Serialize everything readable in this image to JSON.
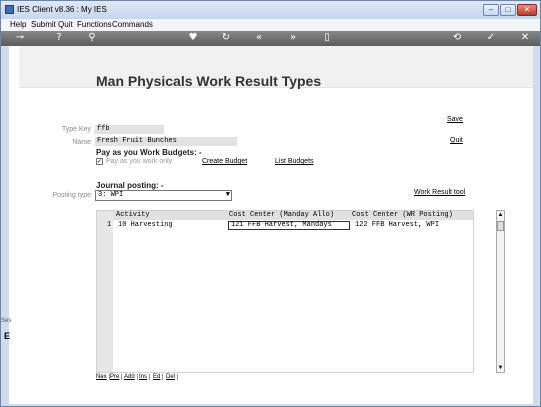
{
  "window": {
    "title": "IES Client v8.36 : My IES"
  },
  "menu": [
    "Help",
    "Submit",
    "Quit",
    "Functions",
    "Commands"
  ],
  "toolbar": {
    "icons": [
      "key-icon",
      "help-icon",
      "search-icon",
      "heart-icon",
      "refresh-icon",
      "rewind-icon",
      "fast-forward-icon",
      "bookmark-icon",
      "back-icon",
      "check-icon",
      "close-icon"
    ]
  },
  "page": {
    "title": "Man Physicals Work Result Types",
    "save_label": "Save",
    "quit_label": "Quit",
    "type_key_label": "Type Key",
    "type_key_value": "ffb",
    "name_label": "Name",
    "name_value": "Fresh Fruit Bunches",
    "pay_heading": "Pay as you Work Budgets: -",
    "pay_checkbox_label": "Pay as you work only",
    "create_budget_label": "Create Budget",
    "list_budgets_label": "List Budgets",
    "journal_heading": "Journal posting: -",
    "posting_type_label": "Posting type",
    "posting_type_value": "3: WPI",
    "work_result_tool_label": "Work Result tool"
  },
  "grid": {
    "headers": [
      "Activity",
      "Cost Center (Manday Allo)",
      "Cost Center (WR Posting)"
    ],
    "rows": [
      {
        "num": "1",
        "activity": "10 Harvesting",
        "cc_manday": "121 FFB Harvest, Mandays",
        "cc_wr": "122 FFB Harvest, WPI"
      }
    ],
    "buttons": [
      "Nex",
      "Pre",
      "Add",
      "Ins",
      "Ed",
      "Del"
    ]
  },
  "side": {
    "s": "Ses",
    "e": "E"
  }
}
